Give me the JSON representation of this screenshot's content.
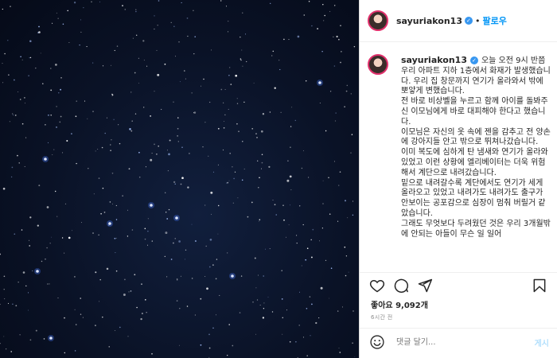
{
  "header": {
    "username": "sayuriakon13",
    "follow_label": "팔로우",
    "separator": "•"
  },
  "post": {
    "username": "sayuriakon13",
    "caption": "오늘 오전 9시 반쯤 우리 아파트 지하 1층에서 화재가 발생했습니다. 우리 집 창문까지 연기가 올라와서 밖에 뽀얗게 변했습니다.\n전 바로 비상벨을 누르고 함께 아이를 돌봐주신 이모님에게 바로 대피해야 한다고 했습니다.\n이모님은 자신의 옷 속에 젠을 감추고 전 양손에 강아지들 안고 밖으로 뛰쳐나갔습니다.\n이미 복도에 심하게 탄 냄새와 연기가 올라와 있었고 이런 상황에 엘리베이터는 더욱 위험해서 계단으로 내려갔습니다.\n밑으로 내려갈수록 계단에서도 연기가 세게 올라오고 있었고 내려가도 내려가도 출구가 안보이는 공포감으로 심장이 멈춰 버릴거 같았습니다.\n그래도 무엇보다 두려웠던 것은 우리 3개월밖에 안되는 아들이 무슨 일 일어"
  },
  "actions": {
    "likes_label": "좋아요 9,092개",
    "time_label": "6시간 전"
  },
  "comment": {
    "placeholder": "댓글 달기...",
    "post_label": "게시"
  },
  "icons": {
    "like": "heart-icon",
    "comment": "comment-icon",
    "share": "share-icon",
    "save": "bookmark-icon",
    "emoji": "emoji-icon",
    "verified": "verified-badge-icon"
  },
  "colors": {
    "accent": "#0095f6",
    "verified": "#3897f0",
    "sky": "#0a1226",
    "post_disabled": "#b2dffc"
  }
}
